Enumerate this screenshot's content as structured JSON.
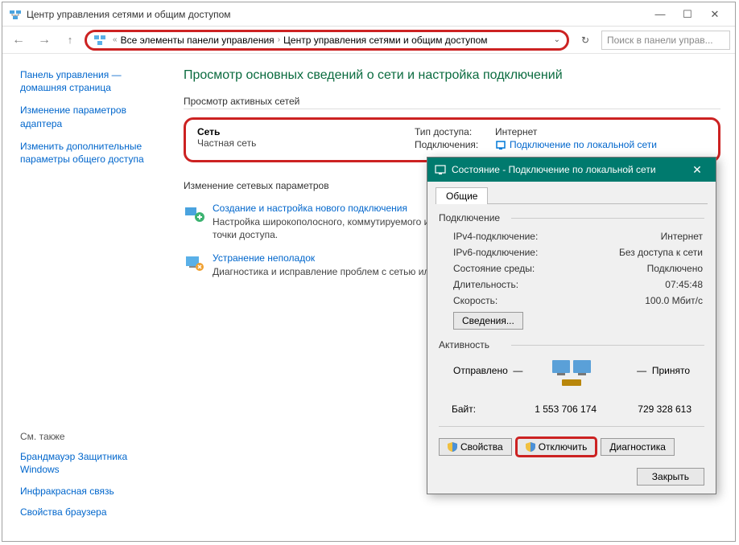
{
  "window": {
    "title": "Центр управления сетями и общим доступом"
  },
  "breadcrumb": {
    "item1": "Все элементы панели управления",
    "item2": "Центр управления сетями и общим доступом"
  },
  "search": {
    "placeholder": "Поиск в панели управ..."
  },
  "sidebar": {
    "link1": "Панель управления — домашняя страница",
    "link2": "Изменение параметров адаптера",
    "link3": "Изменить дополнительные параметры общего доступа",
    "seealso_h": "См. также",
    "seealso1": "Брандмауэр Защитника Windows",
    "seealso2": "Инфракрасная связь",
    "seealso3": "Свойства браузера"
  },
  "main": {
    "title": "Просмотр основных сведений о сети и настройка подключений",
    "active_h": "Просмотр активных сетей",
    "network": {
      "name": "Сеть",
      "type": "Частная сеть",
      "access_lbl": "Тип доступа:",
      "access_val": "Интернет",
      "conn_lbl": "Подключения:",
      "conn_val": "Подключение по локальной сети"
    },
    "change_h": "Изменение сетевых параметров",
    "action1": {
      "title": "Создание и настройка нового подключения",
      "desc": "Настройка широкополосного, коммутируемого или VPN-подключения либо настройка маршрутизатора или точки доступа."
    },
    "action2": {
      "title": "Устранение неполадок",
      "desc": "Диагностика и исправление проблем с сетью или получение сведений об устранении неполадок."
    }
  },
  "dialog": {
    "title": "Состояние - Подключение по локальной сети",
    "tab": "Общие",
    "group1": "Подключение",
    "ipv4_k": "IPv4-подключение:",
    "ipv4_v": "Интернет",
    "ipv6_k": "IPv6-подключение:",
    "ipv6_v": "Без доступа к сети",
    "media_k": "Состояние среды:",
    "media_v": "Подключено",
    "dur_k": "Длительность:",
    "dur_v": "07:45:48",
    "speed_k": "Скорость:",
    "speed_v": "100.0 Мбит/c",
    "details_btn": "Сведения...",
    "group2": "Активность",
    "sent_lbl": "Отправлено",
    "recv_lbl": "Принято",
    "bytes_lbl": "Байт:",
    "sent_bytes": "1 553 706 174",
    "recv_bytes": "729 328 613",
    "btn_props": "Свойства",
    "btn_disable": "Отключить",
    "btn_diag": "Диагностика",
    "btn_close": "Закрыть"
  }
}
